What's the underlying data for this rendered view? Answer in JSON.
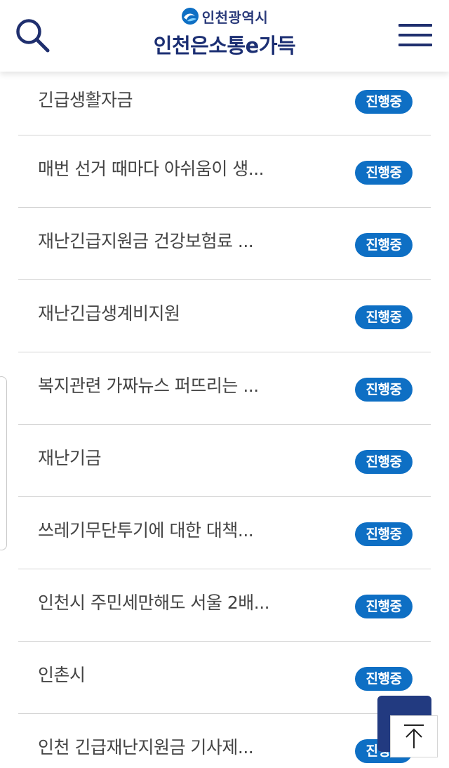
{
  "header": {
    "city_name": "인천광역시",
    "site_title": "인천은소통e가득",
    "search_icon": "search-icon",
    "menu_icon": "hamburger-menu-icon"
  },
  "colors": {
    "brand_navy": "#1c2f73",
    "badge_blue": "#0e6fc4",
    "top_button": "#223a80"
  },
  "list": {
    "items": [
      {
        "title": "긴급생활자금",
        "status": "진행중"
      },
      {
        "title": "매번 선거 때마다 아쉬움이 생...",
        "status": "진행중"
      },
      {
        "title": "재난긴급지원금 건강보험료 ...",
        "status": "진행중"
      },
      {
        "title": "재난긴급생계비지원",
        "status": "진행중"
      },
      {
        "title": "복지관련 가짜뉴스 퍼뜨리는 ...",
        "status": "진행중"
      },
      {
        "title": "재난기금",
        "status": "진행중"
      },
      {
        "title": "쓰레기무단투기에 대한 대책...",
        "status": "진행중"
      },
      {
        "title": "인천시 주민세만해도 서울 2배...",
        "status": "진행중"
      },
      {
        "title": "인촌시",
        "status": "진행중"
      },
      {
        "title": "인천 긴급재난지원금 기사제...",
        "status": "진행중"
      }
    ]
  },
  "scroll_top": {
    "icon": "arrow-up-icon"
  }
}
